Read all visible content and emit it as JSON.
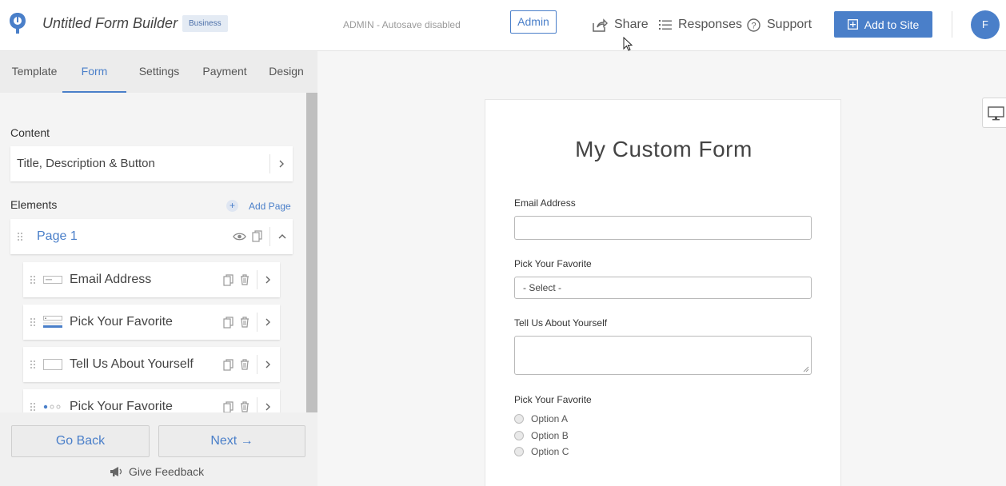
{
  "header": {
    "app_title": "Untitled Form Builder",
    "plan_badge": "Business",
    "autosave_status": "ADMIN - Autosave disabled",
    "admin_label": "Admin",
    "share_label": "Share",
    "responses_label": "Responses",
    "support_label": "Support",
    "add_to_site_label": "Add to Site",
    "avatar_initial": "F",
    "accent_color": "#4a7fc9"
  },
  "sidebar": {
    "tabs": [
      {
        "label": "Template",
        "active": false
      },
      {
        "label": "Form",
        "active": true
      },
      {
        "label": "Settings",
        "active": false
      },
      {
        "label": "Payment",
        "active": false
      },
      {
        "label": "Design",
        "active": false
      }
    ],
    "content_heading": "Content",
    "content_item": "Title, Description & Button",
    "elements_heading": "Elements",
    "add_page_label": "Add Page",
    "page": {
      "title": "Page 1"
    },
    "elements": [
      {
        "label": "Email Address",
        "icon": "text-input-icon"
      },
      {
        "label": "Pick Your Favorite",
        "icon": "dropdown-icon"
      },
      {
        "label": "Tell Us About Yourself",
        "icon": "textarea-icon"
      },
      {
        "label": "Pick Your Favorite",
        "icon": "radio-group-icon"
      }
    ],
    "footer": {
      "back_label": "Go Back",
      "next_label": "Next →",
      "feedback_label": "Give Feedback"
    }
  },
  "form_preview": {
    "title": "My Custom Form",
    "fields": {
      "email_label": "Email Address",
      "favorite_label": "Pick Your Favorite",
      "favorite_selected": "- Select -",
      "about_label": "Tell Us About Yourself",
      "radio_label": "Pick Your Favorite",
      "radio_options": [
        "Option A",
        "Option B",
        "Option C"
      ]
    }
  }
}
